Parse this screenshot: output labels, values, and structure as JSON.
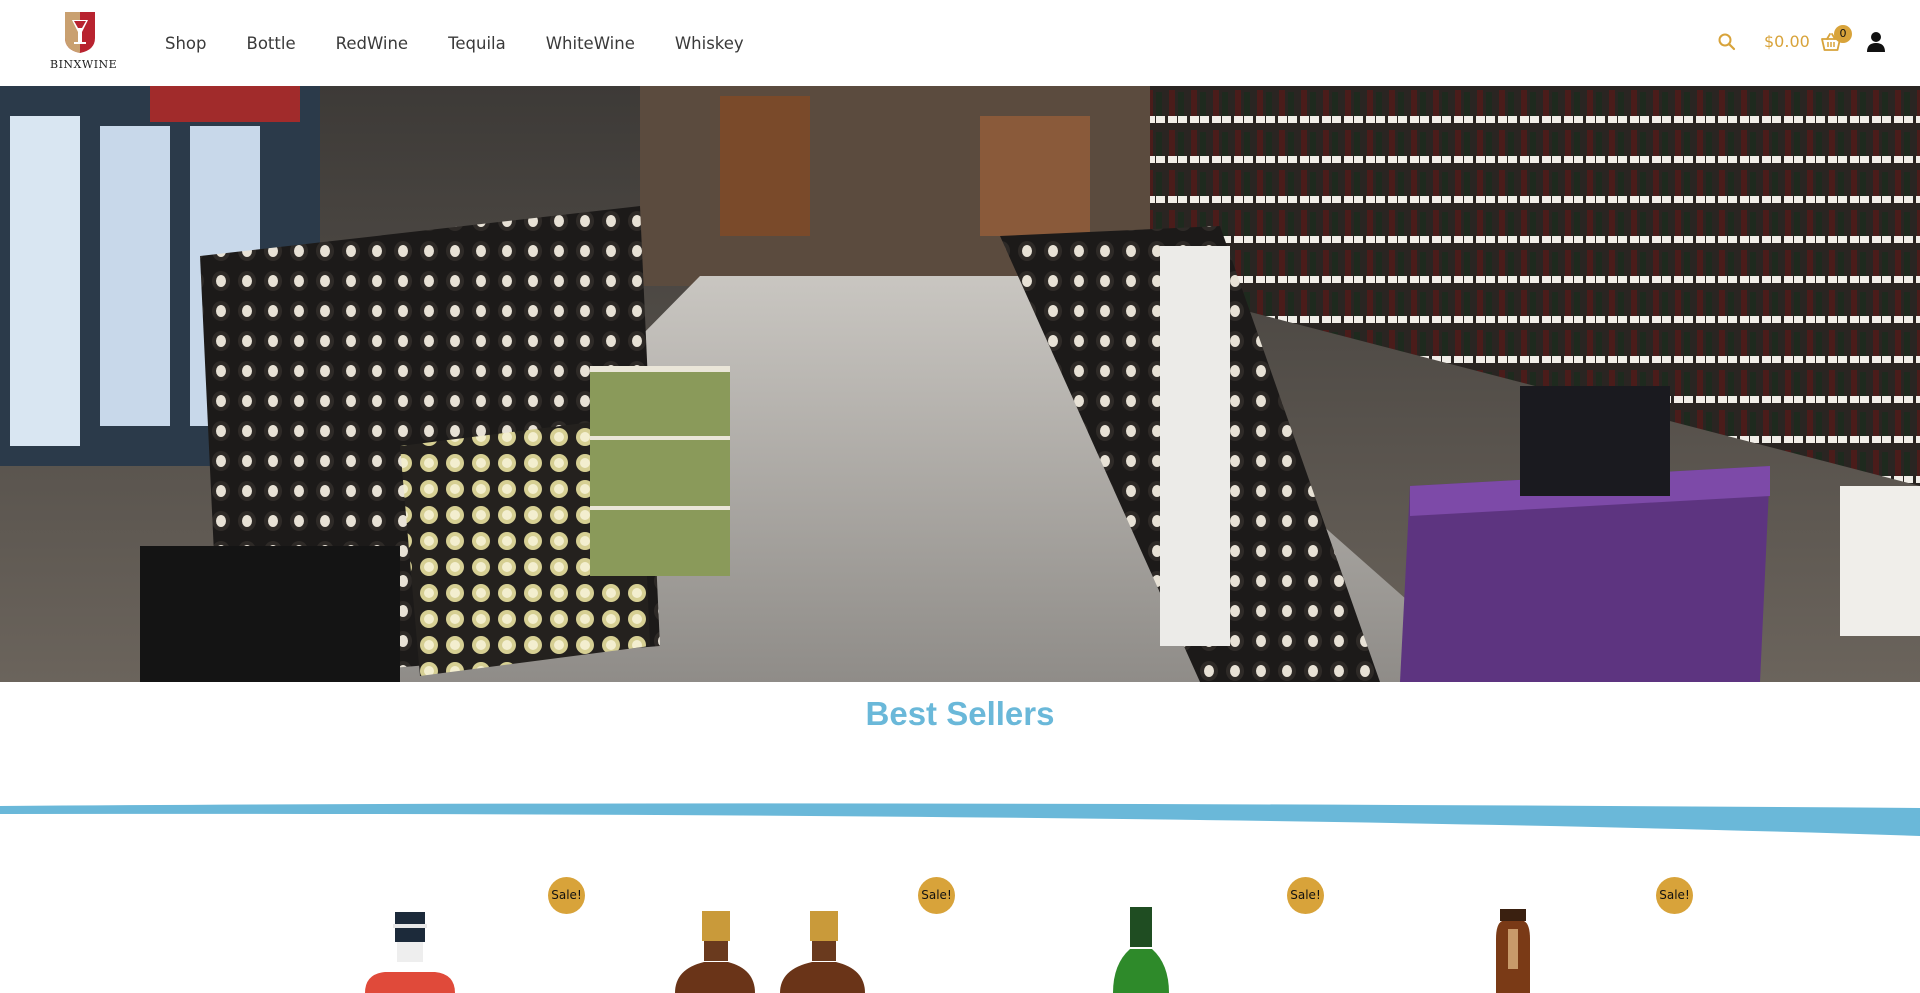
{
  "brand": {
    "name": "BINXWINE",
    "colors": {
      "red": "#b8232f",
      "gold": "#c9a070"
    }
  },
  "nav": {
    "items": [
      {
        "label": "Shop"
      },
      {
        "label": "Bottle"
      },
      {
        "label": "RedWine"
      },
      {
        "label": "Tequila"
      },
      {
        "label": "WhiteWine"
      },
      {
        "label": "Whiskey"
      }
    ]
  },
  "header": {
    "search_icon": "search-icon",
    "cart_total": "$0.00",
    "cart_count": "0",
    "cart_icon": "basket-icon",
    "account_icon": "user-icon",
    "accent_color": "#d8a33a"
  },
  "hero": {
    "image": "wine-store-interior"
  },
  "best_sellers": {
    "title": "Best Sellers",
    "title_color": "#6ab8d9",
    "products": [
      {
        "badge": "Sale!",
        "bottle": "red-liqueur-bottle"
      },
      {
        "badge": "Sale!",
        "bottle": "twin-whiskey-bottles"
      },
      {
        "badge": "Sale!",
        "bottle": "green-wine-bottle"
      },
      {
        "badge": "Sale!",
        "bottle": "dark-brown-bottle"
      }
    ]
  }
}
